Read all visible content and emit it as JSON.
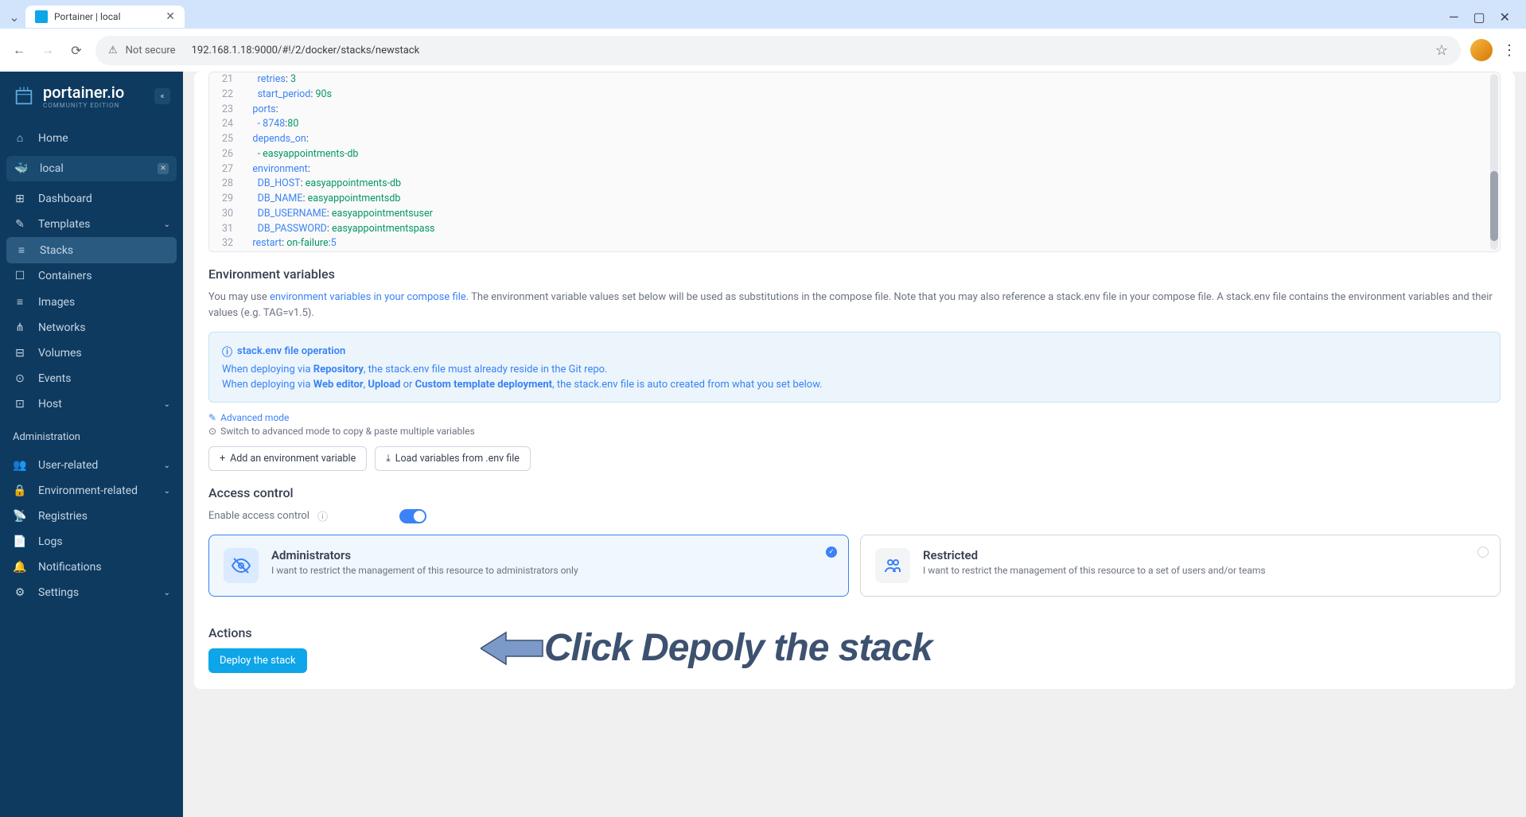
{
  "browser": {
    "tab_title": "Portainer | local",
    "url": "192.168.1.18:9000/#!/2/docker/stacks/newstack",
    "security_label": "Not secure"
  },
  "brand": {
    "name": "portainer.io",
    "edition": "COMMUNITY EDITION"
  },
  "sidebar": {
    "home": "Home",
    "env": "local",
    "items": [
      {
        "icon": "⊞",
        "label": "Dashboard"
      },
      {
        "icon": "✎",
        "label": "Templates",
        "chevron": true
      },
      {
        "icon": "≡",
        "label": "Stacks",
        "active": true
      },
      {
        "icon": "☐",
        "label": "Containers"
      },
      {
        "icon": "≡",
        "label": "Images"
      },
      {
        "icon": "⋔",
        "label": "Networks"
      },
      {
        "icon": "⊟",
        "label": "Volumes"
      },
      {
        "icon": "⊙",
        "label": "Events"
      },
      {
        "icon": "⊡",
        "label": "Host",
        "chevron": true
      }
    ],
    "admin_label": "Administration",
    "admin_items": [
      {
        "icon": "👥",
        "label": "User-related",
        "chevron": true
      },
      {
        "icon": "🔒",
        "label": "Environment-related",
        "chevron": true
      },
      {
        "icon": "📡",
        "label": "Registries"
      },
      {
        "icon": "📄",
        "label": "Logs"
      },
      {
        "icon": "🔔",
        "label": "Notifications"
      },
      {
        "icon": "⚙",
        "label": "Settings",
        "chevron": true
      }
    ]
  },
  "code_lines": [
    {
      "n": 21,
      "indent": 6,
      "key": "retries",
      "val": "3"
    },
    {
      "n": 22,
      "indent": 6,
      "key": "start_period",
      "val": "90s"
    },
    {
      "n": 23,
      "indent": 4,
      "key": "ports",
      "val": ""
    },
    {
      "n": 24,
      "indent": 6,
      "key": "- 8748",
      "val": "80",
      "dash": true
    },
    {
      "n": 25,
      "indent": 4,
      "key": "depends_on",
      "val": ""
    },
    {
      "n": 26,
      "indent": 6,
      "key": "- easyappointments-db",
      "plain": true
    },
    {
      "n": 27,
      "indent": 4,
      "key": "environment",
      "val": ""
    },
    {
      "n": 28,
      "indent": 6,
      "key": "DB_HOST",
      "val": "easyappointments-db"
    },
    {
      "n": 29,
      "indent": 6,
      "key": "DB_NAME",
      "val": "easyappointmentsdb"
    },
    {
      "n": 30,
      "indent": 6,
      "key": "DB_USERNAME",
      "val": "easyappointmentsuser"
    },
    {
      "n": 31,
      "indent": 6,
      "key": "DB_PASSWORD",
      "val": "easyappointmentspass"
    },
    {
      "n": 32,
      "indent": 4,
      "key": "restart",
      "val": "on-failure:",
      "extra": "5"
    }
  ],
  "env_section": {
    "title": "Environment variables",
    "desc_pre": "You may use ",
    "desc_link": "environment variables in your compose file",
    "desc_post": ". The environment variable values set below will be used as substitutions in the compose file. Note that you may also reference a stack.env file in your compose file. A stack.env file contains the environment variables and their values (e.g. TAG=v1.5).",
    "info_title": "stack.env file operation",
    "info_line1_pre": "When deploying via ",
    "info_line1_b": "Repository",
    "info_line1_post": ", the stack.env file must already reside in the Git repo.",
    "info_line2_pre": "When deploying via ",
    "info_line2_b1": "Web editor",
    "info_line2_mid1": ", ",
    "info_line2_b2": "Upload",
    "info_line2_mid2": " or ",
    "info_line2_b3": "Custom template deployment",
    "info_line2_post": ", the stack.env file is auto created from what you set below.",
    "advanced": "Advanced mode",
    "advanced_hint": "Switch to advanced mode to copy & paste multiple variables",
    "btn_add": "Add an environment variable",
    "btn_load": "Load variables from .env file"
  },
  "access": {
    "title": "Access control",
    "toggle_label": "Enable access control",
    "card1_title": "Administrators",
    "card1_desc": "I want to restrict the management of this resource to administrators only",
    "card2_title": "Restricted",
    "card2_desc": "I want to restrict the management of this resource to a set of users and/or teams"
  },
  "actions": {
    "title": "Actions",
    "deploy": "Deploy the stack"
  },
  "annotation": "Click Depoly the stack"
}
